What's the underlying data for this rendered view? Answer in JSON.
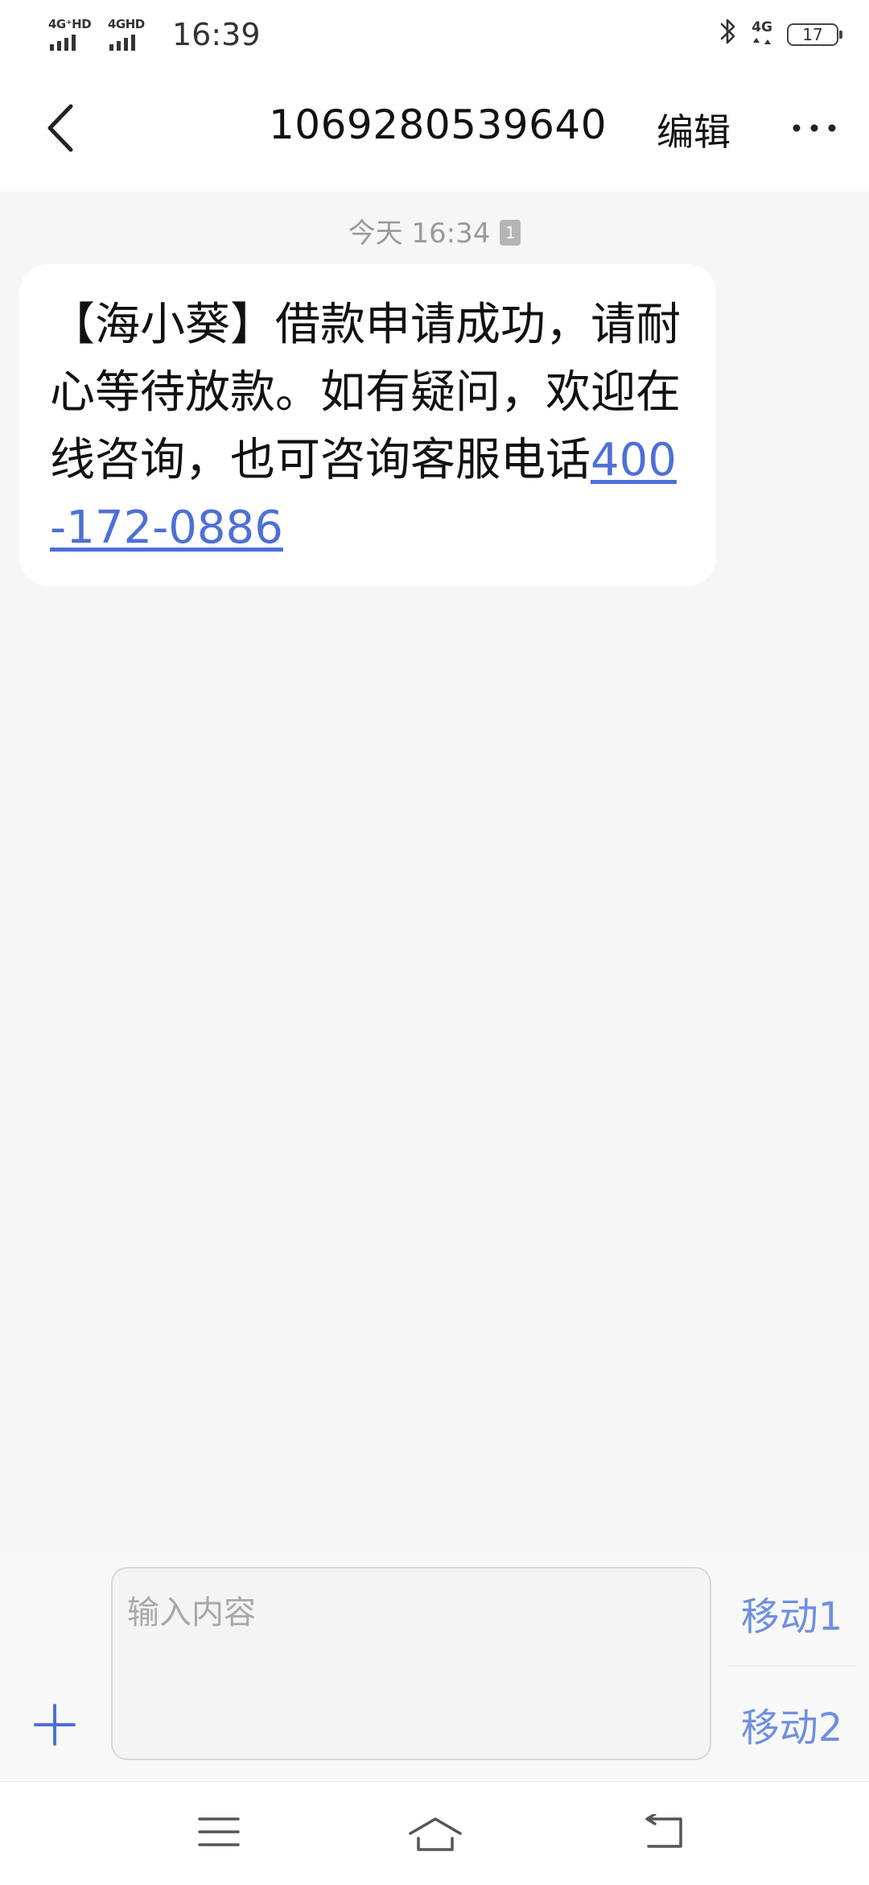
{
  "status_bar": {
    "signal1_label": "4G⁺HD",
    "signal2_label": "4GHD",
    "time": "16:39",
    "network_right": "4G",
    "battery_level": "17"
  },
  "header": {
    "title": "1069280539640",
    "edit_label": "编辑"
  },
  "conversation": {
    "timestamp": "今天 16:34",
    "sim_badge": "1",
    "message_text": "【海小葵】借款申请成功，请耐心等待放款。如有疑问，欢迎在线咨询，也可咨询客服电话",
    "message_phone": "400-172-0886"
  },
  "composer": {
    "placeholder": "输入内容",
    "send_sim1_label": "移动1",
    "send_sim2_label": "移动2"
  },
  "colors": {
    "accent": "#4d6fd9",
    "send": "#6f8fe0"
  }
}
